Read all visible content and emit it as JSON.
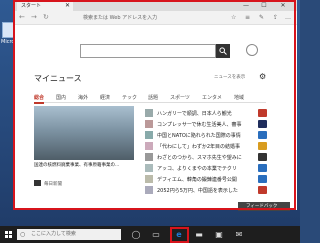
{
  "desktop": {
    "icon_label": "Micro"
  },
  "browser": {
    "tab_title": "スタート",
    "address_placeholder": "検索または Web アドレスを入力",
    "window_controls": [
      "—",
      "☐",
      "✕"
    ]
  },
  "news": {
    "section_title": "マイニュース",
    "settings_label": "ニュースを表示",
    "tabs": [
      "総合",
      "国内",
      "海外",
      "経済",
      "テック",
      "話題",
      "スポーツ",
      "エンタメ",
      "地域"
    ],
    "hero": {
      "caption": "国連の核燃料廃棄事業、有事原籍事業の...",
      "source": "毎日新聞"
    },
    "items": [
      {
        "text": "ハンガリーで順調、日本人ら観光",
        "badge_color": "#c0392b"
      },
      {
        "text": "コンプレッサーで休む生活美人、審事",
        "badge_color": "#1f2d5c"
      },
      {
        "text": "中国とNATOに陥れられた国際の事情",
        "badge_color": "#2a6ebd"
      },
      {
        "text": "「代わにして」わずか2年目の結婚事",
        "badge_color": "#d89c1f"
      },
      {
        "text": "わざとのつから、スマホ先生や望みに",
        "badge_color": "#333333"
      },
      {
        "text": "アッコ、よりくまやの本業でテクリ",
        "badge_color": "#2a6ebd"
      },
      {
        "text": "デフィエム、韓角の鍛錬連番号公開",
        "badge_color": "#2a6ebd"
      },
      {
        "text": "2052円ら5万円、中国語を表示した",
        "badge_color": "#c0392b"
      }
    ]
  },
  "feedback_label": "フィードバック",
  "taskbar": {
    "search_placeholder": "ここに入力して検索"
  },
  "colors": {
    "highlight": "#d7141c",
    "edge_blue": "#1f7bd4"
  }
}
